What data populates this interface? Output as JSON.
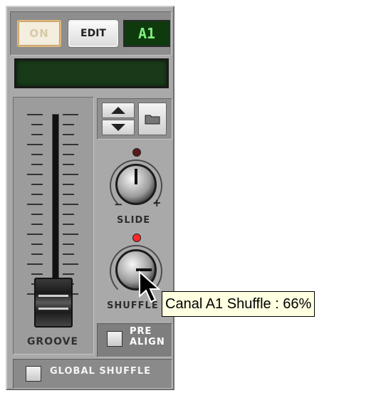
{
  "channel": {
    "on_label": "ON",
    "edit_label": "EDIT",
    "channel_id": "A1",
    "lcd_text": ""
  },
  "knobs": {
    "slide_label": "SLIDE",
    "shuffle_label": "SHUFFLE",
    "minus": "−",
    "plus": "+",
    "slide_led_color": "#5a1a1a",
    "shuffle_led_color": "#ff2a2a"
  },
  "fader": {
    "label": "GROOVE"
  },
  "prealign": {
    "label_line1": "PRE",
    "label_line2": "ALIGN",
    "checked": false
  },
  "global_shuffle": {
    "label": "GLOBAL SHUFFLE",
    "checked": false
  },
  "tooltip": {
    "text": "Canal A1 Shuffle : 66%"
  },
  "icons": {
    "up": "arrow-up-icon",
    "down": "arrow-down-icon",
    "folder": "folder-icon",
    "cursor": "mouse-cursor-icon"
  },
  "colors": {
    "panel": "#a9a9a9",
    "lcd_bg": "#0e3a0e",
    "lcd_text": "#7ef07e",
    "tooltip_bg": "#ffffe1"
  }
}
